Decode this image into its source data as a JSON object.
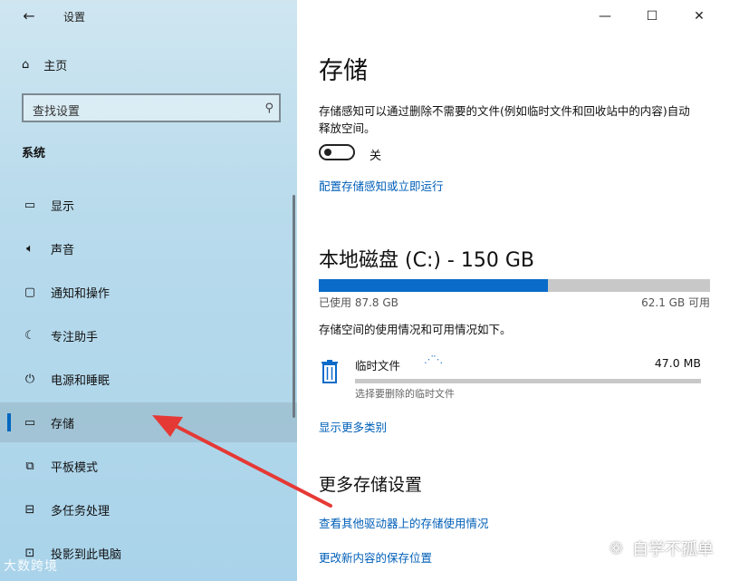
{
  "app": {
    "title": "设置",
    "back_icon": "back-arrow-icon"
  },
  "sidebar": {
    "home_label": "主页",
    "search_placeholder": "查找设置",
    "group_label": "系统",
    "items": [
      {
        "label": "显示",
        "icon": "display-icon"
      },
      {
        "label": "声音",
        "icon": "speaker-icon"
      },
      {
        "label": "通知和操作",
        "icon": "notification-icon"
      },
      {
        "label": "专注助手",
        "icon": "moon-icon"
      },
      {
        "label": "电源和睡眠",
        "icon": "power-icon"
      },
      {
        "label": "存储",
        "icon": "storage-icon",
        "active": true
      },
      {
        "label": "平板模式",
        "icon": "tablet-icon"
      },
      {
        "label": "多任务处理",
        "icon": "multitask-icon"
      },
      {
        "label": "投影到此电脑",
        "icon": "project-icon"
      }
    ]
  },
  "window_controls": {
    "minimize": "—",
    "maximize": "☐",
    "close": "✕"
  },
  "main": {
    "title": "存储",
    "description": "存储感知可以通过删除不需要的文件(例如临时文件和回收站中的内容)自动释放空间。",
    "toggle_state": "关",
    "link_configure": "配置存储感知或立即运行",
    "disk_title": "本地磁盘 (C:) - 150 GB",
    "used": "已使用 87.8 GB",
    "available": "62.1 GB 可用",
    "used_fraction": 0.585,
    "usage_text": "存储空间的使用情况和可用情况如下。",
    "temp_files_label": "临时文件",
    "temp_files_size": "47.0 MB",
    "temp_files_sub": "选择要删除的临时文件",
    "show_more": "显示更多类别",
    "more_settings_title": "更多存储设置",
    "link_other_drives": "查看其他驱动器上的存储使用情况",
    "link_save_location": "更改新内容的保存位置"
  },
  "watermarks": {
    "wechat": "自学不孤单",
    "bottom_left": "大数跨境"
  },
  "colors": {
    "accent": "#0067c0",
    "link": "#005fb8",
    "annotation_arrow": "#e53935"
  }
}
